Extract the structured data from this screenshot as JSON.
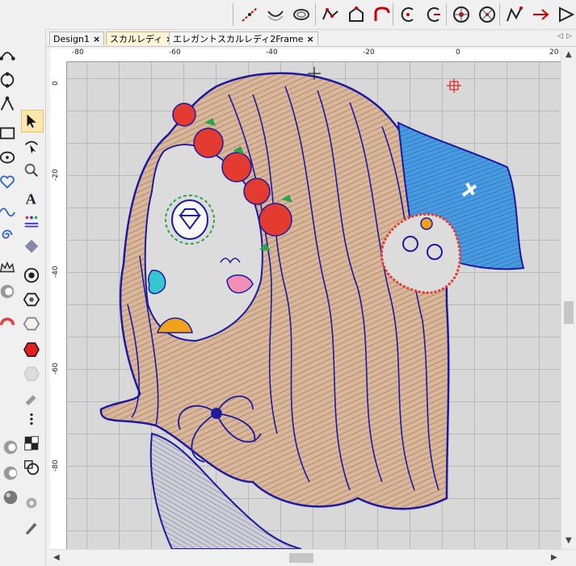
{
  "tabs": [
    {
      "label": "Design1",
      "close": "×"
    },
    {
      "label": "スカルレディ",
      "close": "×"
    },
    {
      "label": "エレガントスカルレディ2Frame",
      "close": "×"
    }
  ],
  "tab_nav": {
    "left": "◁",
    "right": "▷"
  },
  "rulers": {
    "horizontal": [
      "-80",
      "-60",
      "-40",
      "-20",
      "0",
      "20"
    ],
    "vertical": [
      "0",
      "-20",
      "-40",
      "-60",
      "-80"
    ]
  },
  "toolbar": {
    "icons": [
      "reshape-line-icon",
      "curve-icon",
      "ring-icon",
      "polygon-icon",
      "house-shape-icon",
      "arch-icon",
      "letter-c-icon",
      "split-c-icon",
      "rotate-star-icon",
      "rotate-circle-icon",
      "zigzag-icon",
      "arrow-flag-icon",
      "triangle-flag-icon"
    ]
  },
  "left_tools": {
    "col1": [
      "node-curve-icon",
      "node-ring-icon",
      "node-triangle-icon",
      "rectangle-icon",
      "ellipse-node-icon",
      "heart-icon",
      "wave-icon",
      "spiral-icon",
      "crown-icon",
      "rounded-c-icon",
      "fan-icon"
    ],
    "col2": [
      "select-arrow-icon",
      "edit-curve-icon",
      "stitch-icon",
      "text-icon",
      "monogram-icon",
      "applique-icon",
      "circle-target-icon",
      "hexagon-icon",
      "shape-outline-icon",
      "red-hexagon-icon",
      "gray-hexagon-icon",
      "fill-tool-icon",
      "running-stitch-icon",
      "pattern-fill-icon",
      "stamp-icon",
      "double-c-icon",
      "split-shape-icon",
      "sphere-icon",
      "pen-icon",
      "pencil-icon"
    ]
  },
  "colors": {
    "outline": "#1d1aa0",
    "hair": "#d9b79a",
    "rose": "#e33b30",
    "hat": "#4a9ae0",
    "lips": "#35c7d0",
    "nose": "#f28fb8",
    "accent": "#f2a11c",
    "canvas": "#d8d8d8"
  }
}
